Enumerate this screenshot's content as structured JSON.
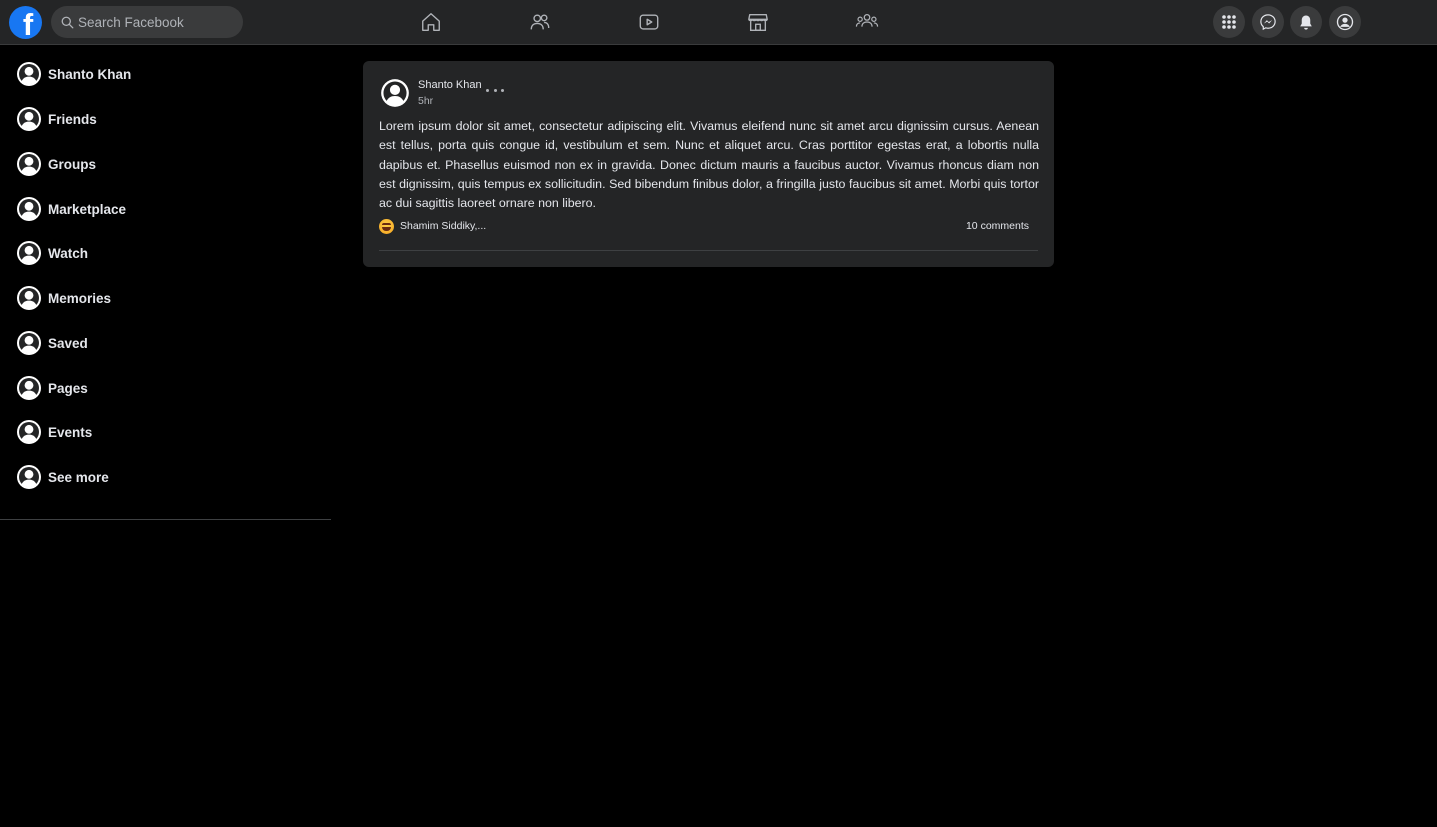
{
  "header": {
    "logo_letter": "f",
    "search": {
      "placeholder": "Search Facebook",
      "value": ""
    },
    "nav_icons": [
      "home-icon",
      "friends-icon",
      "watch-icon",
      "marketplace-icon",
      "groups-icon"
    ],
    "right_buttons": [
      "menu-grid-icon",
      "messenger-icon",
      "notifications-icon",
      "account-icon"
    ]
  },
  "sidebar": {
    "items": [
      {
        "label": "Shanto Khan",
        "icon": "user-avatar-icon"
      },
      {
        "label": "Friends",
        "icon": "user-avatar-icon"
      },
      {
        "label": "Groups",
        "icon": "user-avatar-icon"
      },
      {
        "label": "Marketplace",
        "icon": "user-avatar-icon"
      },
      {
        "label": "Watch",
        "icon": "user-avatar-icon"
      },
      {
        "label": "Memories",
        "icon": "user-avatar-icon"
      },
      {
        "label": "Saved",
        "icon": "user-avatar-icon"
      },
      {
        "label": "Pages",
        "icon": "user-avatar-icon"
      },
      {
        "label": "Events",
        "icon": "user-avatar-icon"
      },
      {
        "label": "See more",
        "icon": "user-avatar-icon"
      }
    ]
  },
  "post": {
    "author": "Shanto Khan",
    "time": "5hr",
    "body": "Lorem ipsum dolor sit amet, consectetur adipiscing elit. Vivamus eleifend nunc sit amet arcu dignissim cursus. Aenean est tellus, porta quis congue id, vestibulum et sem. Nunc et aliquet arcu. Cras porttitor egestas erat, a lobortis nulla dapibus et. Phasellus euismod non ex in gravida. Donec dictum mauris a faucibus auctor. Vivamus rhoncus diam non est dignissim, quis tempus ex sollicitudin. Sed bibendum finibus dolor, a fringilla justo faucibus sit amet. Morbi quis tortor ac dui sagittis laoreet ornare non libero.",
    "reaction_icon": "haha-emoji-icon",
    "reactors": "Shamim Siddiky,...",
    "comments": "10 comments"
  },
  "colors": {
    "page_bg": "#000000",
    "bar_bg": "#242526",
    "card_bg": "#242526",
    "brand_blue": "#1877f2",
    "text_primary": "#e4e6eb",
    "text_secondary": "#b0b3b8"
  }
}
